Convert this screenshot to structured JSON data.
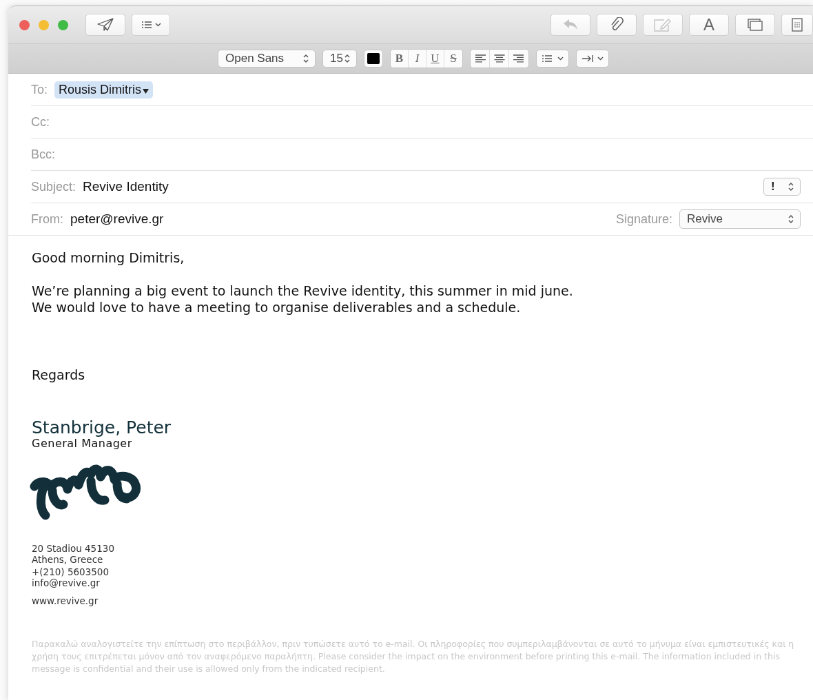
{
  "toolbar": {
    "right_text_button": "A"
  },
  "format_bar": {
    "font": "Open Sans",
    "size": "15",
    "color": "#000000",
    "styles": [
      "B",
      "I",
      "U",
      "S"
    ]
  },
  "header": {
    "to_label": "To:",
    "to_recipient": "Rousis Dimitris",
    "cc_label": "Cc:",
    "bcc_label": "Bcc:",
    "subject_label": "Subject:",
    "subject": "Revive Identity",
    "priority": "!",
    "from_label": "From:",
    "from": "peter@revive.gr",
    "signature_label": "Signature:",
    "signature": "Revive"
  },
  "body": {
    "greeting": "Good morning Dimitris,",
    "paragraph_lines": [
      "We’re planning a big event to launch the Revive identity, this summer in mid june.",
      "We would love to have a meeting to organise deliverables and a schedule."
    ],
    "closing": "Regards"
  },
  "signature_block": {
    "name": "Stanbrige, Peter",
    "role": "General Manager",
    "address": [
      "20 Stadiou 45130",
      "Athens, Greece"
    ],
    "phone": "+(210) 5603500",
    "email": "info@revive.gr",
    "website": "www.revive.gr",
    "disclaimer": "Παρακαλώ αναλογιστείτε την επίπτωση στο περιβάλλον, πριν τυπώσετε αυτό το e-mail. Οι πληροφορίες που συμπεριλαμβάνονται σε αυτό το μήνυμα είναι εμπιστευτικές και η χρήση τους επιτρέπεται μόνον από τον αναφερόμενο παραλήπτη. Please consider the impact on the environment before printing this e-mail. The information included in this message is confidential and their use is allowed only from the indicated recipient."
  }
}
